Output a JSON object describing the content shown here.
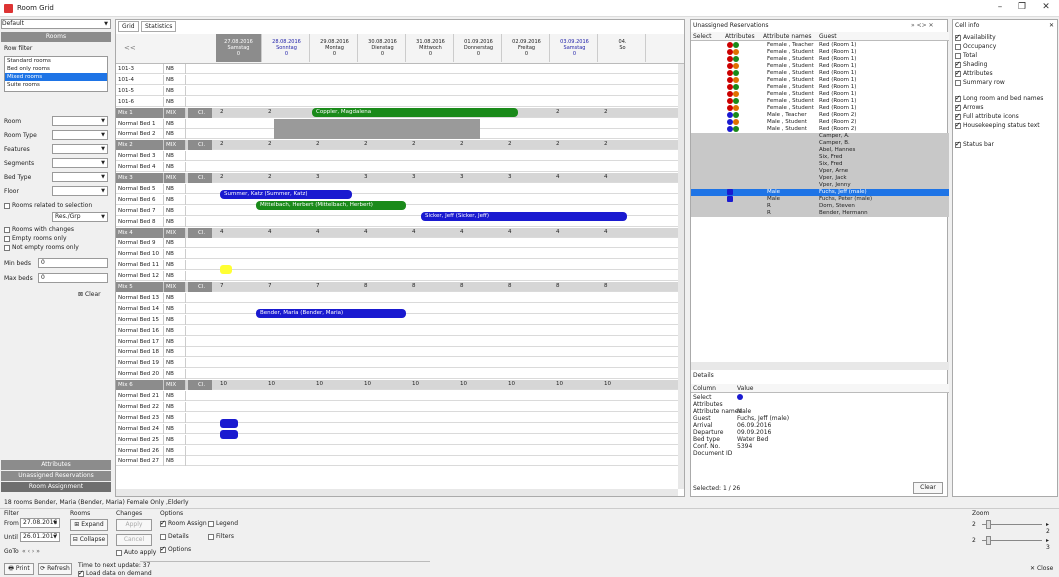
{
  "window": {
    "title": "Room Grid",
    "min": "–",
    "max": "❐",
    "close": "✕"
  },
  "left": {
    "view_select": "Default",
    "rooms_header": "Rooms",
    "row_filter": "Row filter",
    "room_types": [
      "Standard rooms",
      "Bed only rooms",
      "Mixed rooms",
      "Suite rooms"
    ],
    "filters": [
      {
        "label": "Room",
        "value": ""
      },
      {
        "label": "Room Type",
        "value": ""
      },
      {
        "label": "Features",
        "value": ""
      },
      {
        "label": "Segments",
        "value": ""
      },
      {
        "label": "Bed Type",
        "value": ""
      },
      {
        "label": "Floor",
        "value": ""
      }
    ],
    "related": "Rooms related to selection",
    "related_val": "Res./Grp",
    "with_changes": "Rooms with changes",
    "empty_only": "Empty rooms only",
    "not_empty": "Not empty rooms only",
    "min_beds_label": "Min beds",
    "min_beds": "0",
    "max_beds_label": "Max beds",
    "max_beds": "0",
    "clear": "Clear",
    "sections": [
      "Attributes",
      "Unassigned Reservations",
      "Room Assignment"
    ]
  },
  "grid": {
    "tabs": [
      "Grid",
      "Statistics"
    ],
    "nav": "<<",
    "days": [
      {
        "d": "27.08.2016",
        "w": "Samstag",
        "n": "0"
      },
      {
        "d": "28.08.2016",
        "w": "Sonntag",
        "n": "0"
      },
      {
        "d": "29.08.2016",
        "w": "Montag",
        "n": "0"
      },
      {
        "d": "30.08.2016",
        "w": "Dienstag",
        "n": "0"
      },
      {
        "d": "31.08.2016",
        "w": "Mittwoch",
        "n": "0"
      },
      {
        "d": "01.09.2016",
        "w": "Donnerstag",
        "n": "0"
      },
      {
        "d": "02.09.2016",
        "w": "Freitag",
        "n": "0"
      },
      {
        "d": "03.09.2016",
        "w": "Samstag",
        "n": "0"
      },
      {
        "d": "04.",
        "w": "So",
        "n": ""
      }
    ],
    "rows": [
      {
        "n": "101-3",
        "t": "NB",
        "g": false
      },
      {
        "n": "101-4",
        "t": "NB",
        "g": false
      },
      {
        "n": "101-5",
        "t": "NB",
        "g": false
      },
      {
        "n": "101-6",
        "t": "NB",
        "g": false
      },
      {
        "n": "Mix 1",
        "t": "MIX",
        "g": true,
        "c": [
          "2",
          "2",
          "2",
          "2",
          "2",
          "2",
          "2",
          "2",
          "2"
        ]
      },
      {
        "n": "Normal Bed 1",
        "t": "NB",
        "g": false
      },
      {
        "n": "Normal Bed 2",
        "t": "NB",
        "g": false
      },
      {
        "n": "Mix 2",
        "t": "MIX",
        "g": true,
        "c": [
          "2",
          "2",
          "2",
          "2",
          "2",
          "2",
          "2",
          "2",
          "2"
        ]
      },
      {
        "n": "Normal Bed 3",
        "t": "NB",
        "g": false
      },
      {
        "n": "Normal Bed 4",
        "t": "NB",
        "g": false
      },
      {
        "n": "Mix 3",
        "t": "MIX",
        "g": true,
        "c": [
          "2",
          "2",
          "3",
          "3",
          "3",
          "3",
          "3",
          "4",
          "4"
        ]
      },
      {
        "n": "Normal Bed 5",
        "t": "NB",
        "g": false
      },
      {
        "n": "Normal Bed 6",
        "t": "NB",
        "g": false
      },
      {
        "n": "Normal Bed 7",
        "t": "NB",
        "g": false
      },
      {
        "n": "Normal Bed 8",
        "t": "NB",
        "g": false
      },
      {
        "n": "Mix 4",
        "t": "MIX",
        "g": true,
        "c": [
          "4",
          "4",
          "4",
          "4",
          "4",
          "4",
          "4",
          "4",
          "4"
        ]
      },
      {
        "n": "Normal Bed 9",
        "t": "NB",
        "g": false
      },
      {
        "n": "Normal Bed 10",
        "t": "NB",
        "g": false
      },
      {
        "n": "Normal Bed 11",
        "t": "NB",
        "g": false
      },
      {
        "n": "Normal Bed 12",
        "t": "NB",
        "g": false
      },
      {
        "n": "Mix 5",
        "t": "MIX",
        "g": true,
        "c": [
          "7",
          "7",
          "7",
          "8",
          "8",
          "8",
          "8",
          "8",
          "8"
        ]
      },
      {
        "n": "Normal Bed 13",
        "t": "NB",
        "g": false
      },
      {
        "n": "Normal Bed 14",
        "t": "NB",
        "g": false
      },
      {
        "n": "Normal Bed 15",
        "t": "NB",
        "g": false
      },
      {
        "n": "Normal Bed 16",
        "t": "NB",
        "g": false
      },
      {
        "n": "Normal Bed 17",
        "t": "NB",
        "g": false
      },
      {
        "n": "Normal Bed 18",
        "t": "NB",
        "g": false
      },
      {
        "n": "Normal Bed 19",
        "t": "NB",
        "g": false
      },
      {
        "n": "Normal Bed 20",
        "t": "NB",
        "g": false
      },
      {
        "n": "Mix 6",
        "t": "MIX",
        "g": true,
        "c": [
          "10",
          "10",
          "10",
          "10",
          "10",
          "10",
          "10",
          "10",
          "10"
        ]
      },
      {
        "n": "Normal Bed 21",
        "t": "NB",
        "g": false
      },
      {
        "n": "Normal Bed 22",
        "t": "NB",
        "g": false
      },
      {
        "n": "Normal Bed 23",
        "t": "NB",
        "g": false
      },
      {
        "n": "Normal Bed 24",
        "t": "NB",
        "g": false
      },
      {
        "n": "Normal Bed 25",
        "t": "NB",
        "g": false
      },
      {
        "n": "Normal Bed 26",
        "t": "NB",
        "g": false
      },
      {
        "n": "Normal Bed 27",
        "t": "NB",
        "g": false
      }
    ],
    "bars": [
      {
        "label": "Coppler, Magdalena",
        "color": "#1a8a1a"
      },
      {
        "label": "Summer, Katz (Summer, Katz)",
        "color": "#1a1ad0"
      },
      {
        "label": "Mittelbach, Herbert (Mittelbach, Herbert)",
        "color": "#1a8a1a"
      },
      {
        "label": "Sicker, Jeff (Sicker, Jeff)",
        "color": "#1a1ad0"
      },
      {
        "label": "Bender, Maria (Bender, Maria)",
        "color": "#1a1ad0"
      }
    ],
    "mix_cell": "Cl."
  },
  "unassigned": {
    "title": "Unassigned Reservations",
    "cols": [
      "Select",
      "Attributes",
      "Attribute names",
      "Guest"
    ],
    "rows": [
      {
        "a": "Female , Teacher",
        "g": "Red (Room 1)"
      },
      {
        "a": "Female , Student",
        "g": "Red (Room 1)"
      },
      {
        "a": "Female , Student",
        "g": "Red (Room 1)"
      },
      {
        "a": "Female , Student",
        "g": "Red (Room 1)"
      },
      {
        "a": "Female , Student",
        "g": "Red (Room 1)"
      },
      {
        "a": "Female , Student",
        "g": "Red (Room 1)"
      },
      {
        "a": "Female , Student",
        "g": "Red (Room 1)"
      },
      {
        "a": "Female , Student",
        "g": "Red (Room 1)"
      },
      {
        "a": "Female , Student",
        "g": "Red (Room 1)"
      },
      {
        "a": "Female , Student",
        "g": "Red (Room 1)"
      },
      {
        "a": "Male , Teacher",
        "g": "Red (Room 2)"
      },
      {
        "a": "Male , Student",
        "g": "Red (Room 2)"
      },
      {
        "a": "Male , Student",
        "g": "Red (Room 2)"
      },
      {
        "a": "",
        "g": "Camper, A."
      },
      {
        "a": "",
        "g": "Camper, B."
      },
      {
        "a": "",
        "g": "Abel, Hannes"
      },
      {
        "a": "",
        "g": "Six, Fred"
      },
      {
        "a": "",
        "g": "Six, Fred"
      },
      {
        "a": "",
        "g": "Vper, Arne"
      },
      {
        "a": "",
        "g": "Vper, Jack"
      },
      {
        "a": "",
        "g": "Vper, Jenny"
      },
      {
        "a": "Male",
        "g": "Fuchs, Jeff (male)"
      },
      {
        "a": "Male",
        "g": "Fuchs, Peter (male)"
      },
      {
        "a": "R",
        "g": "Dorn, Steven"
      },
      {
        "a": "R",
        "g": "Bender, Hermann"
      }
    ],
    "details_title": "Details",
    "detail_cols": [
      "Column",
      "Value"
    ],
    "details": [
      {
        "k": "Select",
        "v": ""
      },
      {
        "k": "Attributes",
        "v": ""
      },
      {
        "k": "Attribute names",
        "v": "Male"
      },
      {
        "k": "Guest",
        "v": "Fuchs, Jeff (male)"
      },
      {
        "k": "Arrival",
        "v": "06.09.2016"
      },
      {
        "k": "Departure",
        "v": "09.09.2016"
      },
      {
        "k": "Bed type",
        "v": "Water Bed"
      },
      {
        "k": "Conf. No.",
        "v": "5394"
      },
      {
        "k": "Document ID",
        "v": ""
      }
    ],
    "selected": "Selected: 1 / 26",
    "clear": "Clear"
  },
  "cellinfo": {
    "title": "Cell info",
    "items": [
      {
        "l": "Availability",
        "on": true
      },
      {
        "l": "Occupancy",
        "on": false
      },
      {
        "l": "Total",
        "on": false
      },
      {
        "l": "Shading",
        "on": true
      },
      {
        "l": "Attributes",
        "on": true
      },
      {
        "l": "Summary row",
        "on": false
      }
    ],
    "items2": [
      {
        "l": "Long room and bed names",
        "on": true
      },
      {
        "l": "Arrows",
        "on": true
      },
      {
        "l": "Full attribute icons",
        "on": true
      },
      {
        "l": "Housekeeping status text",
        "on": true
      }
    ],
    "statusbar": "Status bar"
  },
  "bottom": {
    "status": "18 rooms Bender, Maria (Bender, Maria) Female Only ,Elderly",
    "filter": "Filter",
    "from_label": "From",
    "from": "27.08.2016",
    "until_label": "Until",
    "until": "26.01.2017",
    "goto": "GoTo",
    "rooms": "Rooms",
    "expand": "Expand",
    "collapse": "Collapse",
    "changes": "Changes",
    "apply": "Apply",
    "cancel": "Cancel",
    "auto_apply": "Auto apply",
    "options": "Options",
    "room_assign": "Room Assign",
    "legend": "Legend",
    "details": "Details",
    "filters": "Filters",
    "options_chk": "Options",
    "print": "Print",
    "refresh": "Refresh",
    "next_update": "Time to next update: 37",
    "load_demand": "Load data on demand",
    "zoom": "Zoom",
    "zoom1": "2",
    "zoom2": "2",
    "close": "Close"
  }
}
